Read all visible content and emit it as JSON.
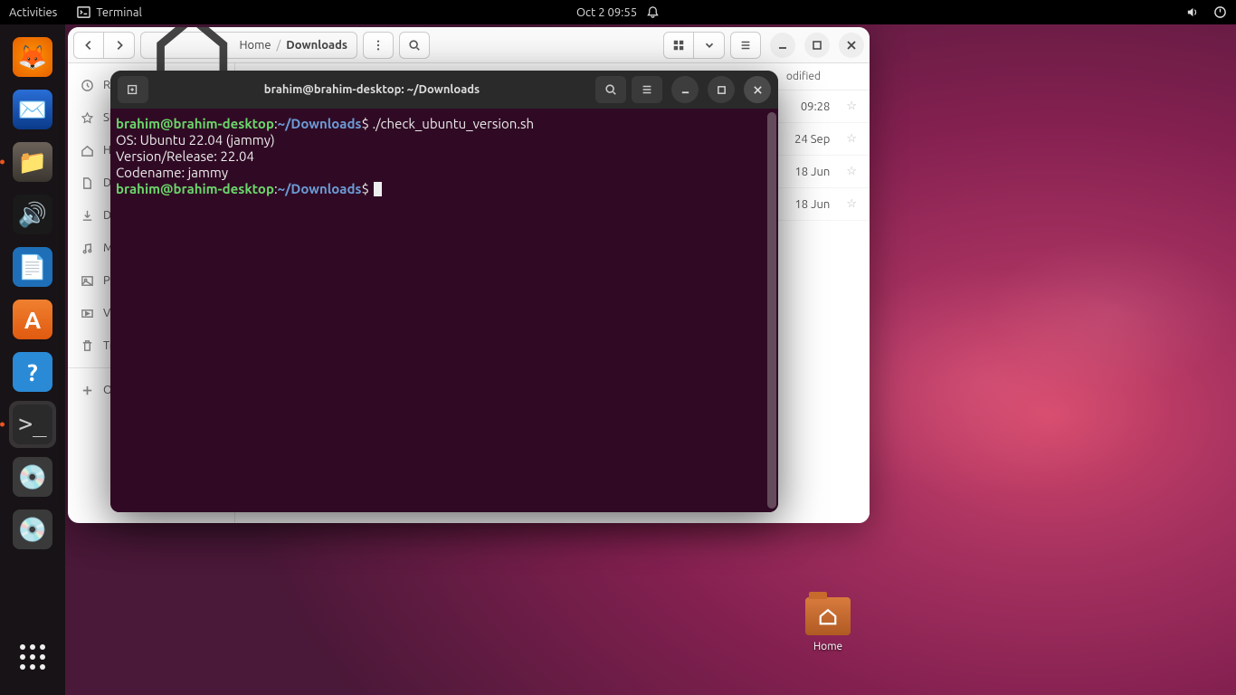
{
  "topbar": {
    "activities": "Activities",
    "app_indicator": "Terminal",
    "datetime": "Oct 2  09:55"
  },
  "dock": {
    "items": [
      {
        "name": "firefox",
        "label": "Firefox"
      },
      {
        "name": "thunderbird",
        "label": "Thunderbird"
      },
      {
        "name": "files",
        "label": "Files"
      },
      {
        "name": "rhythmbox",
        "label": "Rhythmbox"
      },
      {
        "name": "writer",
        "label": "LibreOffice Writer"
      },
      {
        "name": "software",
        "label": "Ubuntu Software"
      },
      {
        "name": "help",
        "label": "Help"
      },
      {
        "name": "terminal",
        "label": "Terminal"
      },
      {
        "name": "disk1",
        "label": "Disk"
      },
      {
        "name": "disk2",
        "label": "Disk"
      }
    ],
    "apps_label": "Show Applications"
  },
  "nautilus": {
    "breadcrumb": {
      "home": "Home",
      "current": "Downloads"
    },
    "columns": {
      "modified": "odified"
    },
    "sidebar": [
      "Re",
      "St",
      "H",
      "D",
      "D",
      "M",
      "P",
      "V",
      "Tr",
      "O"
    ],
    "rows": [
      {
        "modified": "09:28"
      },
      {
        "modified": "24 Sep"
      },
      {
        "modified": "18 Jun"
      },
      {
        "modified": "18 Jun"
      }
    ]
  },
  "terminal": {
    "title": "brahim@brahim-desktop: ~/Downloads",
    "prompt_user": "brahim@brahim-desktop",
    "prompt_sep": ":",
    "prompt_path": "~/Downloads",
    "prompt_dollar": "$",
    "lines": [
      {
        "type": "cmd",
        "text": "./check_ubuntu_version.sh"
      },
      {
        "type": "out",
        "text": "OS: Ubuntu 22.04 (jammy)"
      },
      {
        "type": "out",
        "text": "Version/Release: 22.04"
      },
      {
        "type": "out",
        "text": "Codename: jammy"
      }
    ]
  },
  "desktop": {
    "home_label": "Home"
  }
}
